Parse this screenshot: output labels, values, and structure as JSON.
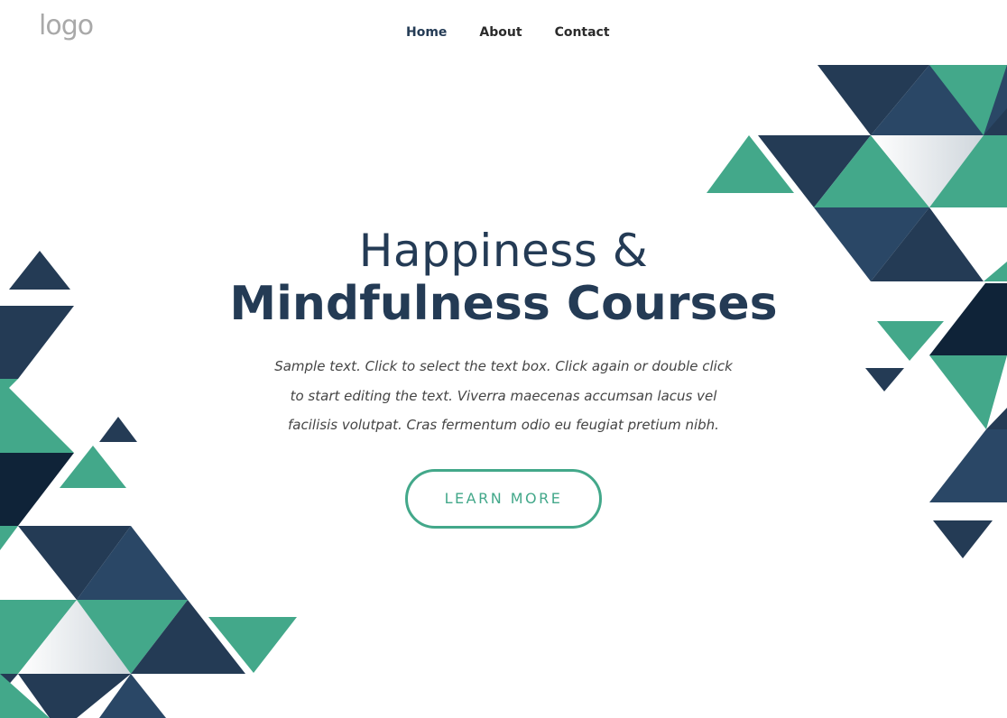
{
  "header": {
    "logo_text": "logo",
    "nav": [
      {
        "label": "Home"
      },
      {
        "label": "About"
      },
      {
        "label": "Contact"
      }
    ]
  },
  "hero": {
    "title_line1": "Happiness &",
    "title_line2": "Mindfulness Courses",
    "description": "Sample text. Click to select the text box. Click again or double click to start editing the text. Viverra maecenas accumsan lacus vel facilisis volutpat. Cras fermentum odio eu feugiat pretium nibh.",
    "button_label": "LEARN MORE"
  },
  "colors": {
    "navy": "#243b55",
    "dark_navy": "#0f2338",
    "teal": "#43a88a",
    "white": "#ffffff"
  }
}
